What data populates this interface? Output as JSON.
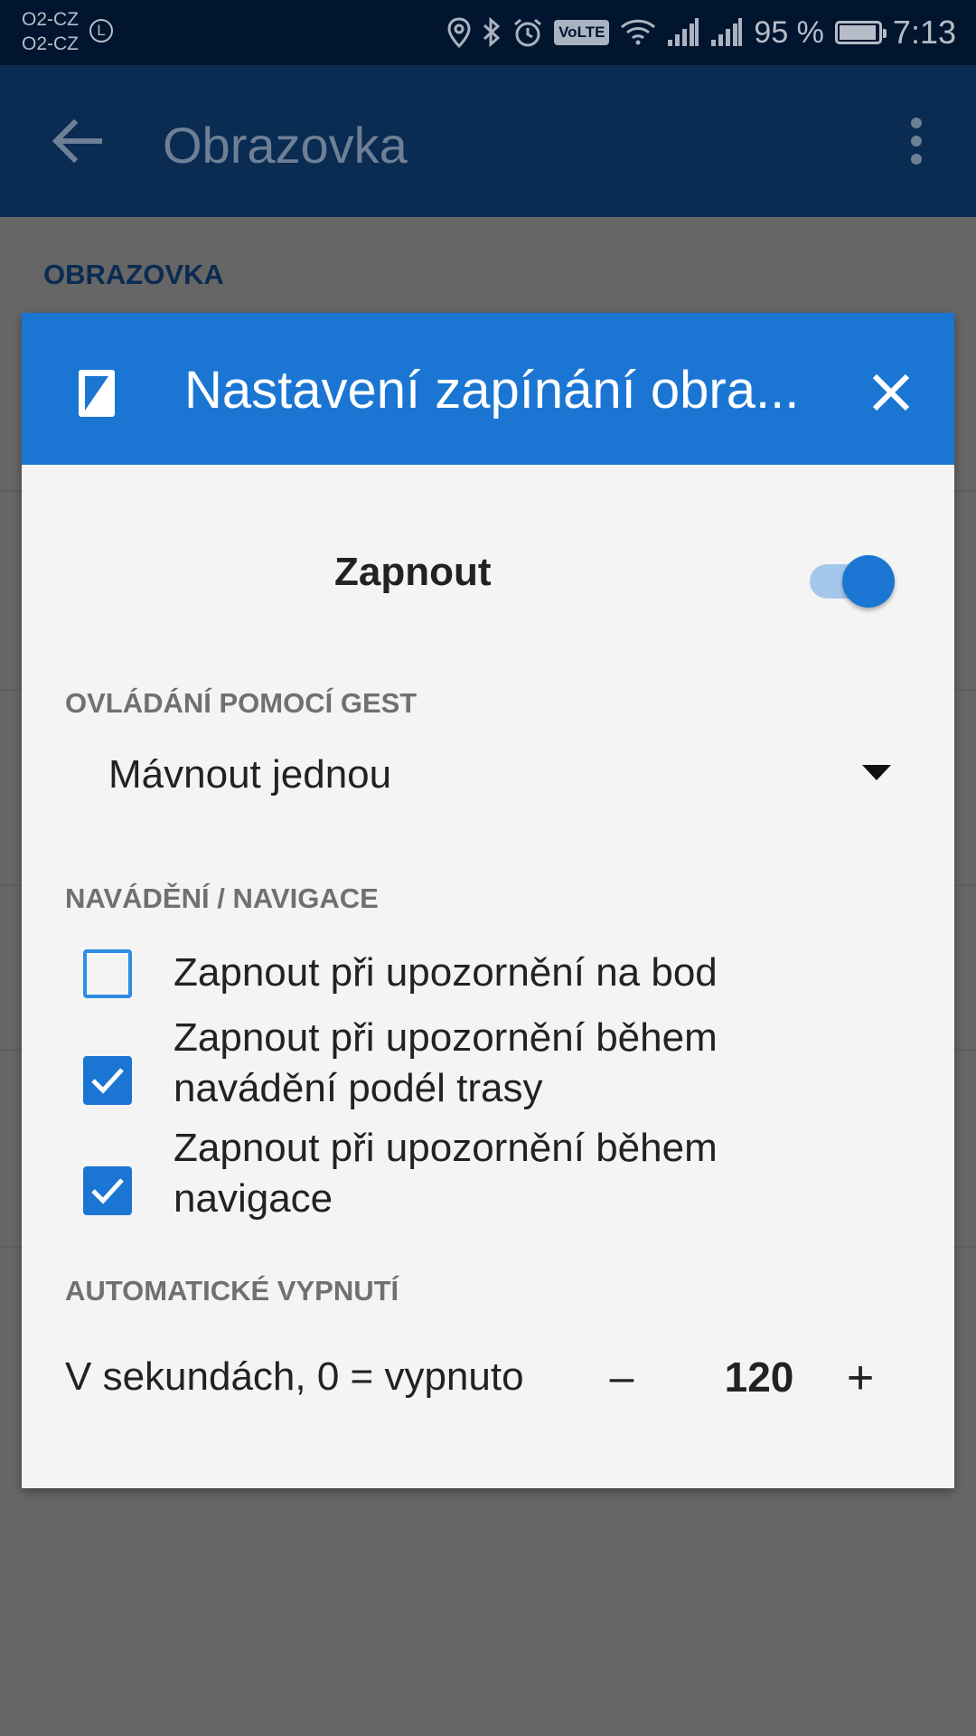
{
  "status_bar": {
    "carrier_1": "O2-CZ",
    "carrier_2": "O2-CZ",
    "carrier_badge": "L",
    "volte_label": "VoLTE",
    "battery_percent": "95 %",
    "battery_level": 0.95,
    "time": "7:13",
    "icons": [
      "location-icon",
      "bluetooth-icon",
      "alarm-icon",
      "volte-icon",
      "wifi-icon",
      "signal-icon",
      "signal-icon",
      "battery-icon"
    ]
  },
  "app_bar": {
    "title": "Obrazovka",
    "back_icon": "arrow-back-icon",
    "menu_icon": "more-vert-icon"
  },
  "background": {
    "section_label": "OBRAZOVKA"
  },
  "dialog": {
    "title": "Nastavení zapínání obra...",
    "icon": "screen-icon",
    "close_icon": "close-icon",
    "accent_color": "#1b76d3",
    "enable": {
      "label": "Zapnout",
      "checked": true
    },
    "gestures": {
      "label": "OVLÁDÁNÍ POMOCÍ GEST",
      "selected": "Mávnout jednou"
    },
    "navigation": {
      "label": "NAVÁDĚNÍ / NAVIGACE",
      "options": [
        {
          "line1": "Zapnout při upozornění na bod",
          "line2": "",
          "checked": false
        },
        {
          "line1": "Zapnout při upozornění během",
          "line2": "navádění podél trasy",
          "checked": true
        },
        {
          "line1": "Zapnout při upozornění během",
          "line2": "navigace",
          "checked": true
        }
      ]
    },
    "auto_off": {
      "label": "AUTOMATICKÉ VYPNUTÍ",
      "description": "V sekundách, 0 = vypnuto",
      "minus": "–",
      "value": "120",
      "plus": "+"
    }
  }
}
